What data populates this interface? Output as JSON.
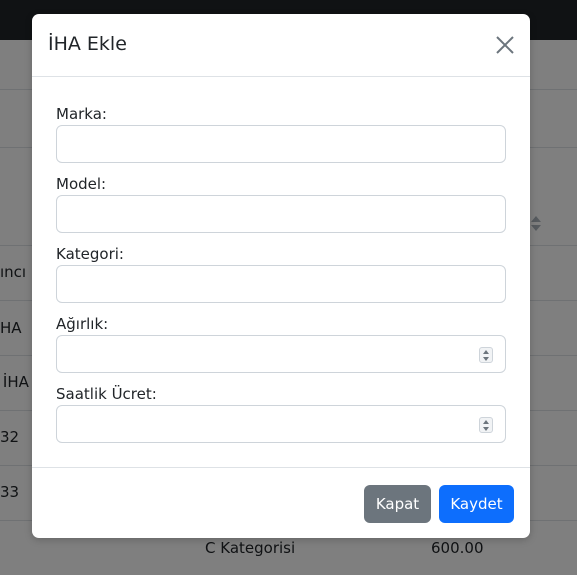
{
  "background": {
    "table_rows": [
      {
        "col1": "ıncı"
      },
      {
        "col1": "HA"
      },
      {
        "col1": "i İHA"
      },
      {
        "col1": "32"
      },
      {
        "col1": "33"
      },
      {
        "col2": "C Kategorisi",
        "col3": "600.00"
      }
    ]
  },
  "modal": {
    "title": "İHA Ekle",
    "fields": [
      {
        "label": "Marka:",
        "value": "",
        "type": "text"
      },
      {
        "label": "Model:",
        "value": "",
        "type": "text"
      },
      {
        "label": "Kategori:",
        "value": "",
        "type": "text"
      },
      {
        "label": "Ağırlık:",
        "value": "",
        "type": "number"
      },
      {
        "label": "Saatlik Ücret:",
        "value": "",
        "type": "number"
      }
    ],
    "buttons": {
      "close_label": "Kapat",
      "save_label": "Kaydet"
    }
  },
  "colors": {
    "primary": "#0d6efd",
    "secondary": "#6c757d",
    "navbar": "#212529"
  },
  "icons": {
    "close": "close-icon",
    "sort": "sort-icon",
    "spinner": "number-spinner-icon"
  }
}
